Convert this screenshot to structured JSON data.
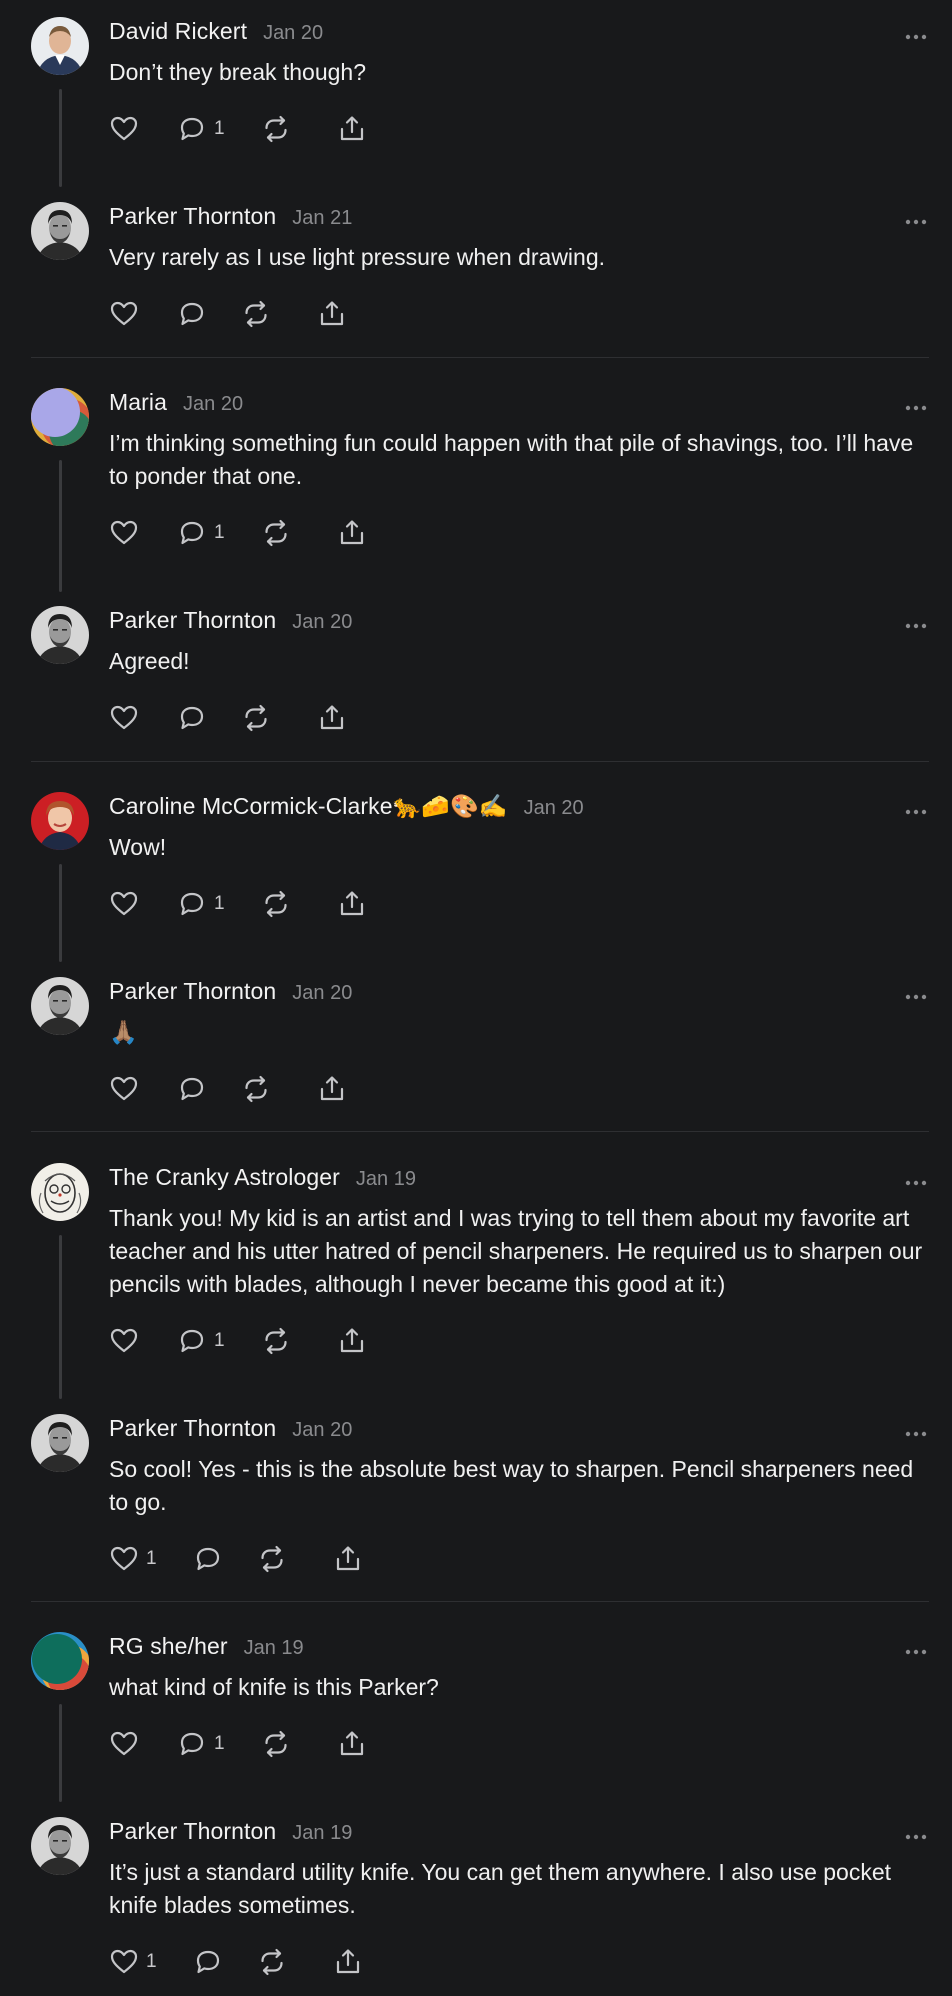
{
  "posts": [
    {
      "author": "David Rickert",
      "date": "Jan 20",
      "text": "Don’t they break though?",
      "reply_count": "1",
      "like_count": ""
    },
    {
      "author": "Parker Thornton",
      "date": "Jan 21",
      "text": "Very rarely as I use light pressure when drawing.",
      "reply_count": "",
      "like_count": ""
    },
    {
      "author": "Maria",
      "date": "Jan 20",
      "text": "I’m thinking something fun could happen with that pile of shavings, too. I’ll have to ponder that one.",
      "reply_count": "1",
      "like_count": ""
    },
    {
      "author": "Parker Thornton",
      "date": "Jan 20",
      "text": "Agreed!",
      "reply_count": "",
      "like_count": ""
    },
    {
      "author": "Caroline McCormick-Clarke🐆🧀🎨✍️",
      "date": "Jan 20",
      "text": "Wow!",
      "reply_count": "1",
      "like_count": ""
    },
    {
      "author": "Parker Thornton",
      "date": "Jan 20",
      "text": "🙏🏽",
      "reply_count": "",
      "like_count": ""
    },
    {
      "author": "The Cranky Astrologer",
      "date": "Jan 19",
      "text": "Thank you! My kid is an artist and I was trying to tell them about my favorite art teacher and his utter hatred of pencil sharpeners. He required us to sharpen our pencils with blades, although I never became this good at it:)",
      "reply_count": "1",
      "like_count": ""
    },
    {
      "author": "Parker Thornton",
      "date": "Jan 20",
      "text": "So cool! Yes - this is the absolute best way to sharpen. Pencil sharpeners need to go.",
      "reply_count": "",
      "like_count": "1"
    },
    {
      "author": "RG she/her",
      "date": "Jan 19",
      "text": "what kind of knife is this Parker?",
      "reply_count": "1",
      "like_count": ""
    },
    {
      "author": "Parker Thornton",
      "date": "Jan 19",
      "text": "It’s just a standard utility knife. You can get them anywhere. I also use pocket knife blades sometimes.",
      "reply_count": "",
      "like_count": "1"
    }
  ],
  "icons": {
    "like": "heart-icon",
    "reply": "comment-icon",
    "repost": "repost-icon",
    "share": "share-icon",
    "more": "more-icon"
  },
  "colors": {
    "background": "#18191b",
    "text": "#f2f2f2",
    "muted": "#8a8b8e",
    "divider": "#2e2f32",
    "thread_line": "#3a3b3e"
  }
}
